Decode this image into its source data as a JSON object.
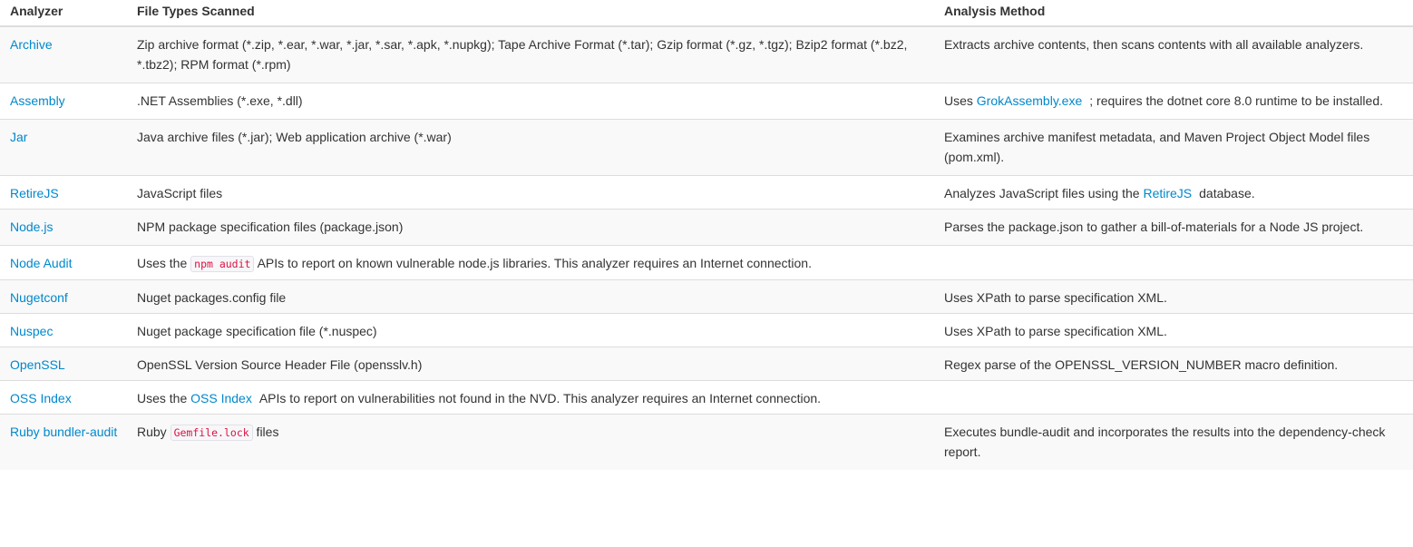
{
  "table": {
    "headers": {
      "analyzer": "Analyzer",
      "file_types": "File Types Scanned",
      "method": "Analysis Method"
    },
    "rows": [
      {
        "analyzer": "Archive",
        "file_types": "Zip archive format (*.zip, *.ear, *.war, *.jar, *.sar, *.apk, *.nupkg); Tape Archive Format (*.tar); Gzip format (*.gz, *.tgz); Bzip2 format (*.bz2, *.tbz2); RPM format (*.rpm)",
        "method": "Extracts archive contents, then scans contents with all available analyzers."
      },
      {
        "analyzer": "Assembly",
        "file_types": ".NET Assemblies (*.exe, *.dll)",
        "method_pre": "Uses ",
        "method_link": "GrokAssembly.exe",
        "method_post": "; requires the dotnet core 8.0 runtime to be installed."
      },
      {
        "analyzer": "Jar",
        "file_types": "Java archive files (*.jar); Web application archive (*.war)",
        "method": "Examines archive manifest metadata, and Maven Project Object Model files (pom.xml)."
      },
      {
        "analyzer": "RetireJS",
        "file_types": "JavaScript files",
        "method_pre": "Analyzes JavaScript files using the ",
        "method_link": "RetireJS",
        "method_post": "database."
      },
      {
        "analyzer": "Node.js",
        "file_types": "NPM package specification files (package.json)",
        "method": "Parses the package.json to gather a bill-of-materials for a Node JS project."
      },
      {
        "analyzer": "Node Audit",
        "file_types_pre": "Uses the ",
        "file_types_code": "npm audit",
        "file_types_post": " APIs to report on known vulnerable node.js libraries. This analyzer requires an Internet connection."
      },
      {
        "analyzer": "Nugetconf",
        "file_types": "Nuget packages.config file",
        "method": "Uses XPath to parse specification XML."
      },
      {
        "analyzer": "Nuspec",
        "file_types": "Nuget package specification file (*.nuspec)",
        "method": "Uses XPath to parse specification XML."
      },
      {
        "analyzer": "OpenSSL",
        "file_types": "OpenSSL Version Source Header File (opensslv.h)",
        "method": "Regex parse of the OPENSSL_VERSION_NUMBER macro definition."
      },
      {
        "analyzer": "OSS Index",
        "file_types_pre": "Uses the ",
        "file_types_link": "OSS Index",
        "file_types_post": "APIs to report on vulnerabilities not found in the NVD. This analyzer requires an Internet connection."
      },
      {
        "analyzer": "Ruby bundler-audit",
        "file_types_pre": "Ruby ",
        "file_types_code": "Gemfile.lock",
        "file_types_post": " files",
        "method": "Executes bundle-audit and incorporates the results into the dependency-check report."
      }
    ]
  }
}
